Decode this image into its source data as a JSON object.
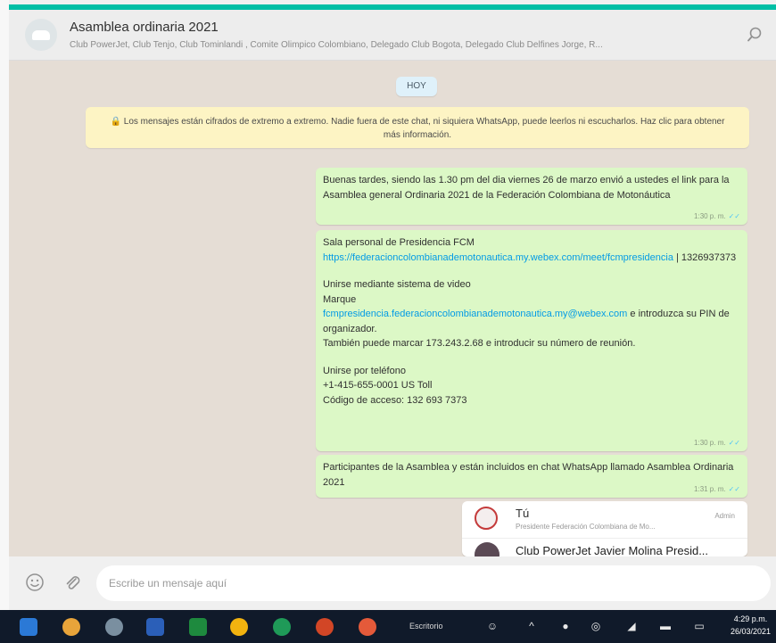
{
  "header": {
    "title": "Asamblea ordinaria 2021",
    "subtitle": "Club PowerJet, Club Tenjo, Club Tominlandi , Comite Olimpico Colombiano, Delegado Club Bogota, Delegado Club Delfines Jorge, R...",
    "search_icon": "search-icon"
  },
  "chat": {
    "day_label": "HOY",
    "encryption_notice": "🔒 Los mensajes están cifrados de extremo a extremo. Nadie fuera de este chat, ni siquiera WhatsApp, puede leerlos ni escucharlos. Haz clic para obtener más información.",
    "messages": [
      {
        "text": "Buenas tardes, siendo las 1.30 pm del dia viernes 26 de marzo envió a ustedes el link para la Asamblea general Ordinaria 2021 de la Federación Colombiana de Motonáutica",
        "time": "1:30 p. m."
      },
      {
        "line1": "Sala personal de Presidencia FCM",
        "link1": "https://federacioncolombianademotonautica.my.webex.com/meet/fcmpresidencia",
        "after_link1": " | 1326937373",
        "video_title": "Unirse mediante sistema de video",
        "video_dial": "Marque",
        "link2": "fcmpresidencia.federacioncolombianademotonautica.my@webex.com",
        "after_link2": " e introduzca su PIN de organizador.",
        "video_alt": "También puede marcar 173.243.2.68 e introducir su número de reunión.",
        "phone_title": "Unirse por teléfono",
        "phone_number": "+1-415-655-0001 US Toll",
        "access_code": "Código de acceso: 132 693 7373",
        "time": "1:30 p. m."
      },
      {
        "text": "Participantes de la Asamblea y están incluidos en chat WhatsApp llamado Asamblea Ordinaria 2021",
        "time": "1:31 p. m."
      }
    ],
    "check_mark": "✓✓",
    "participants": [
      {
        "name": "Tú",
        "subtitle": "Presidente Federación Colombiana de Mo...",
        "role": "Admin"
      },
      {
        "name": "Club PowerJet Javier Molina Presid..."
      }
    ]
  },
  "composer": {
    "placeholder": "Escribe un mensaje aquí",
    "emoji_icon": "emoji-icon",
    "attach_icon": "paperclip-icon"
  },
  "taskbar": {
    "desktop_label": "Escritorio",
    "time": "4:29 p.m.",
    "date": "26/03/2021",
    "app_colors": [
      "#2b79d6",
      "#e8a43a",
      "#7a8fa0",
      "#2b5fb8",
      "#1e8a3e",
      "#f2b30f",
      "#1f9a58",
      "#d24626",
      "#e45a3a"
    ]
  },
  "colors": {
    "accent": "#00bfa5",
    "outgoing_bubble": "#dcf8c6",
    "notice_bg": "#fdf4c4",
    "chat_bg": "#e5ddd5",
    "link": "#039be5"
  }
}
